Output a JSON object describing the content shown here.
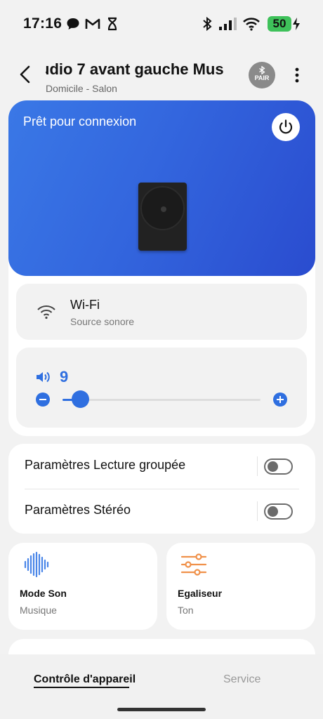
{
  "status_bar": {
    "time": "17:16",
    "battery": "50",
    "icons": [
      "chat-bubble-icon",
      "gmail-icon",
      "hourglass-icon",
      "bluetooth-icon",
      "signal-icon",
      "wifi-icon",
      "charging-bolt-icon"
    ]
  },
  "header": {
    "title": "udio 7 avant gauche   Mus",
    "subtitle": "Domicile - Salon",
    "pair_label": "PAIR",
    "back_icon": "chevron-left-icon",
    "more_icon": "more-vertical-icon"
  },
  "hero": {
    "status": "Prêt pour connexion",
    "power_icon": "power-icon",
    "gradient": [
      "#3a78e6",
      "#2a4ccf"
    ]
  },
  "source": {
    "name": "Wi-Fi",
    "sub": "Source sonore",
    "icon": "wifi-icon"
  },
  "volume": {
    "value": "9",
    "level": 0.09,
    "icon": "speaker-volume-icon",
    "accent": "#2f6fe0"
  },
  "settings": {
    "group_play": {
      "label": "Paramètres Lecture groupée",
      "enabled": false
    },
    "stereo": {
      "label": "Paramètres Stéréo",
      "enabled": false
    }
  },
  "tiles": {
    "sound_mode": {
      "title": "Mode Son",
      "sub": "Musique",
      "icon": "sound-wave-icon"
    },
    "equalizer": {
      "title": "Egaliseur",
      "sub": "Ton",
      "icon": "equalizer-sliders-icon"
    }
  },
  "bottom_nav": {
    "tabs": [
      "Contrôle d'appareil",
      "Service"
    ],
    "active": 0
  }
}
